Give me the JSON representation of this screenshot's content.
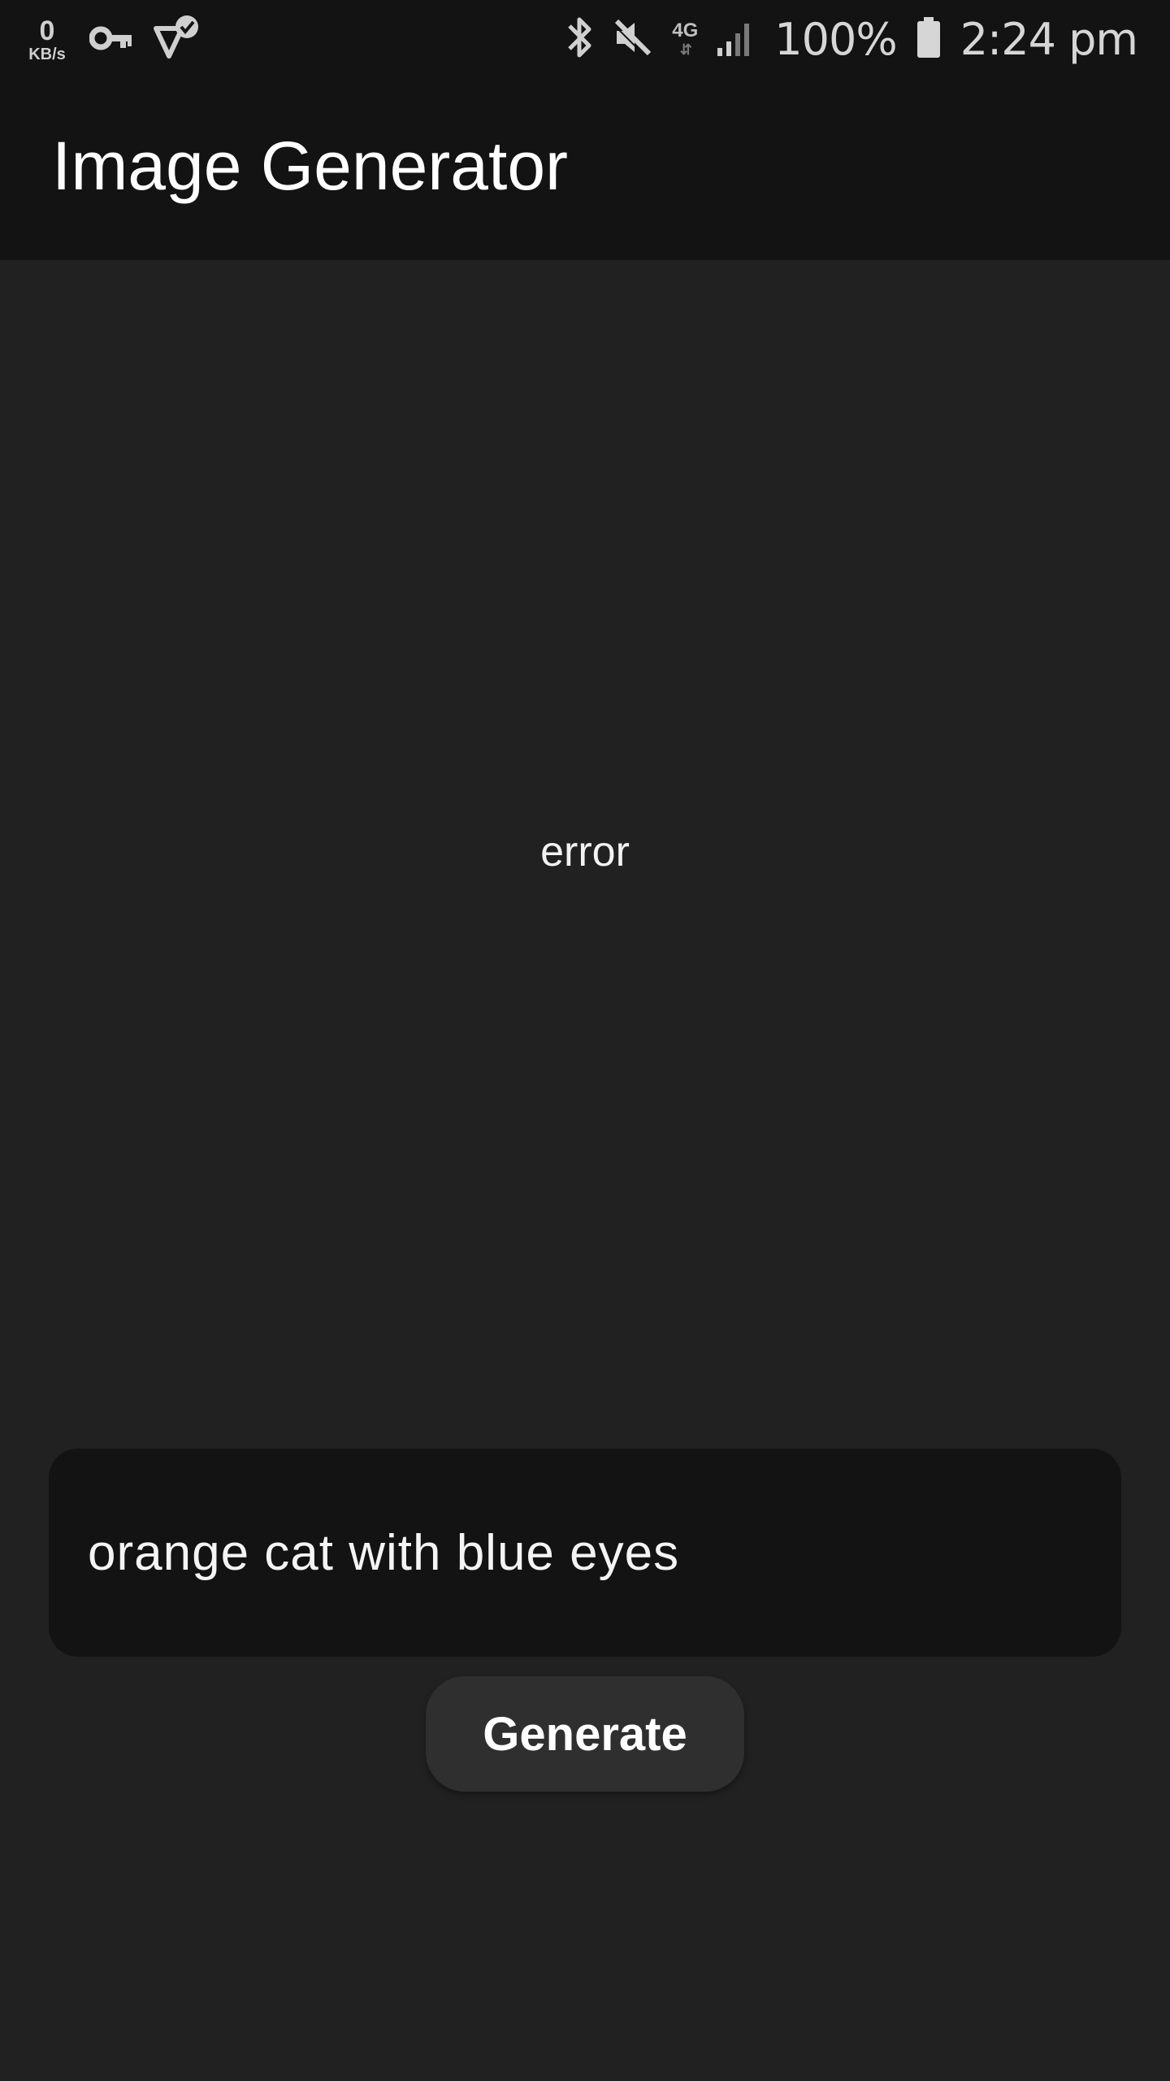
{
  "status_bar": {
    "net_speed_value": "0",
    "net_speed_unit": "KB/s",
    "network_type": "4G",
    "battery": "100%",
    "time": "2:24 pm",
    "icons": [
      "vpn-key-icon",
      "location-check-icon",
      "bluetooth-icon",
      "mute-icon",
      "signal-icon",
      "battery-icon"
    ]
  },
  "app_bar": {
    "title": "Image Generator"
  },
  "main": {
    "status_message": "error",
    "prompt": {
      "value": "orange cat with blue eyes",
      "placeholder": ""
    },
    "generate_label": "Generate"
  },
  "colors": {
    "background": "#212121",
    "bar": "#131313",
    "input_bg": "#131313",
    "button_bg": "#2f2f2f",
    "text": "#ffffff"
  }
}
